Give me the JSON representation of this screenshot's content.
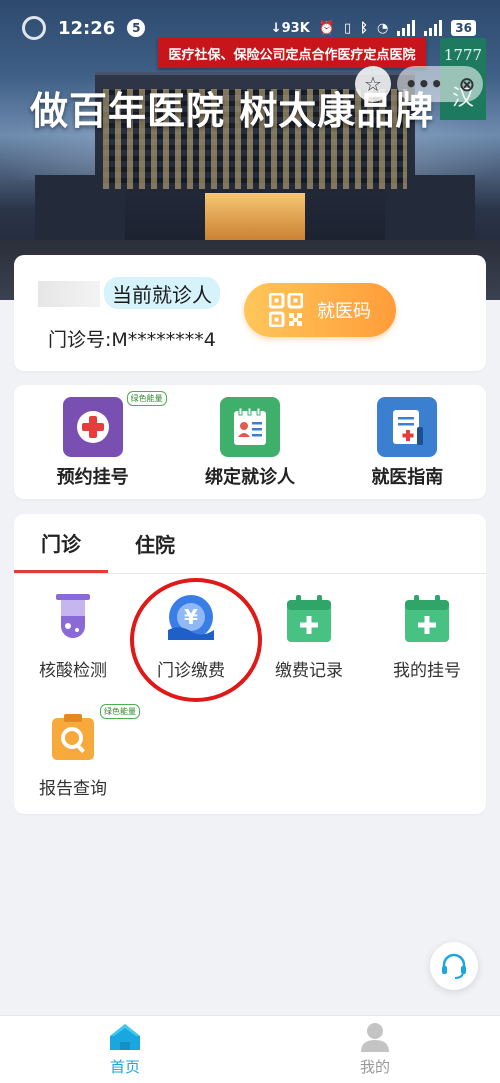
{
  "status_bar": {
    "time": "12:26",
    "notification_count": "5",
    "net_speed": "93K",
    "battery": "36"
  },
  "banner": {
    "ribbon_text": "医疗社保、保险公司定点合作医疗定点医院",
    "headline": "做百年医院 树太康品牌",
    "calligraphy_top": "1777",
    "calligraphy_bottom": "汉"
  },
  "patient_card": {
    "current_tag": "当前就诊人",
    "clinic_number": "门诊号:M********4",
    "qr_button_label": "就医码"
  },
  "quick_services": [
    {
      "label": "预约挂号",
      "icon": "hospital-cross-icon",
      "color": "#7a4fb2",
      "tag": "绿色能量"
    },
    {
      "label": "绑定就诊人",
      "icon": "patient-id-card-icon",
      "color": "#3faf6c",
      "tag": ""
    },
    {
      "label": "就医指南",
      "icon": "medical-guide-icon",
      "color": "#3b7fd1",
      "tag": ""
    }
  ],
  "tabs": {
    "outpatient": "门诊",
    "inpatient": "住院"
  },
  "outpatient_services": [
    {
      "label": "核酸检测",
      "icon": "test-tube-icon",
      "color": "#8a6ad6",
      "tag": ""
    },
    {
      "label": "门诊缴费",
      "icon": "payment-icon",
      "color": "#3a7de6",
      "tag": ""
    },
    {
      "label": "缴费记录",
      "icon": "calendar-plus-icon",
      "color": "#47c283",
      "tag": ""
    },
    {
      "label": "我的挂号",
      "icon": "calendar-plus-icon",
      "color": "#47c283",
      "tag": ""
    },
    {
      "label": "报告查询",
      "icon": "report-search-icon",
      "color": "#f7a93b",
      "tag": "绿色能量"
    }
  ],
  "bottom_nav": {
    "home": "首页",
    "mine": "我的",
    "active_color": "#1aa7e0"
  }
}
